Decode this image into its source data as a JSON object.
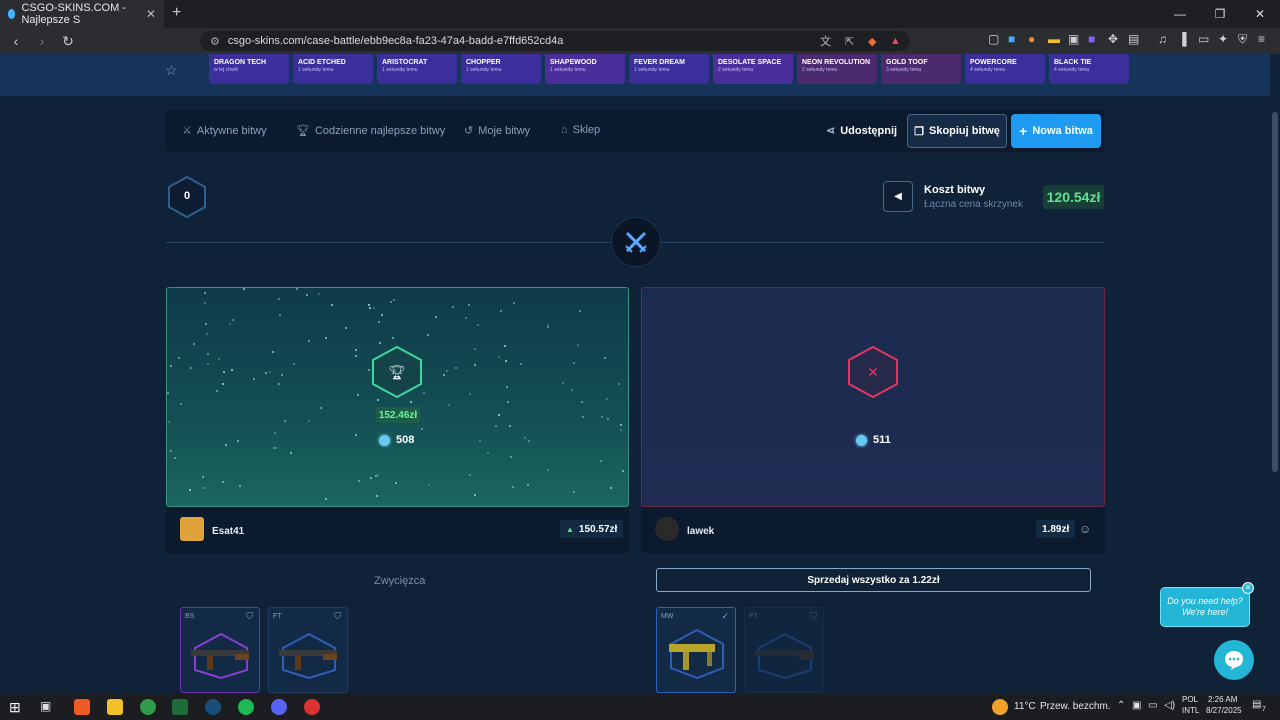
{
  "browser": {
    "tab_title": "CSGO-SKINS.COM - Najlepsze S",
    "tab_close": "✕",
    "new_tab": "+",
    "url": "csgo-skins.com/case-battle/ebb9ec8a-fa23-47a4-badd-e7ffd652cd4a",
    "win_min": "—",
    "win_max": "❐",
    "win_close": "✕"
  },
  "cases": [
    {
      "name": "DRAGON TECH",
      "time": "w tej chwili",
      "color": "#3b2f9c"
    },
    {
      "name": "ACID ETCHED",
      "time": "1 sekundę temu",
      "color": "#3b2f9c"
    },
    {
      "name": "ARISTOCRAT",
      "time": "1 sekundę temu",
      "color": "#3b2f9c"
    },
    {
      "name": "CHOPPER",
      "time": "1 sekundę temu",
      "color": "#3b2f9c"
    },
    {
      "name": "SHAPEWOOD",
      "time": "1 sekundę temu",
      "color": "#4a2f9c"
    },
    {
      "name": "FEVER DREAM",
      "time": "1 sekundę temu",
      "color": "#3b2f9c"
    },
    {
      "name": "DESOLATE SPACE",
      "time": "2 sekundy temu",
      "color": "#4a2f9c"
    },
    {
      "name": "NEON REVOLUTION",
      "time": "2 sekundy temu",
      "color": "#4b2a6e"
    },
    {
      "name": "GOLD TOOF",
      "time": "3 sekundy temu",
      "color": "#4b2a6e"
    },
    {
      "name": "POWERCORE",
      "time": "4 sekundy temu",
      "color": "#3b2f9c"
    },
    {
      "name": "BLACK TIE",
      "time": "4 sekundy temu",
      "color": "#3b2f9c"
    }
  ],
  "nav": {
    "active": "Aktywne bitwy",
    "daily": "Codzienne najlepsze bitwy",
    "mine": "Moje bitwy",
    "shop": "Sklep",
    "share": "Udostępnij",
    "copy": "Skopiuj bitwę",
    "new": "Nowa bitwa"
  },
  "battle": {
    "round": "0",
    "cost_title": "Koszt bitwy",
    "cost_sub": "Łączna cena skrzynek",
    "cost_value": "120.54zł"
  },
  "left": {
    "prize": "152.46zł",
    "coins": "508",
    "player": "Esat41",
    "player_value": "150.57zł",
    "status": "Zwycięzca",
    "items": [
      {
        "cond": "BS"
      },
      {
        "cond": "FT"
      }
    ]
  },
  "right": {
    "coins": "511",
    "player": "lawek",
    "player_value": "1.89zł",
    "sell": "Sprzedaj wszystko za 1.22zł",
    "items": [
      {
        "cond": "MW"
      },
      {
        "cond": "FT"
      }
    ]
  },
  "chat": {
    "bubble": "Do you need help? We're here!"
  },
  "taskbar": {
    "temp": "11°C",
    "weather": "Przew. bezchm.",
    "lang1": "POL",
    "lang2": "INTL",
    "time": "2:26 AM",
    "date": "8/27/2025",
    "notif": "7"
  },
  "colors": {
    "accent": "#1e9bf0",
    "win": "#5ee38f",
    "lose": "#e0365f"
  }
}
